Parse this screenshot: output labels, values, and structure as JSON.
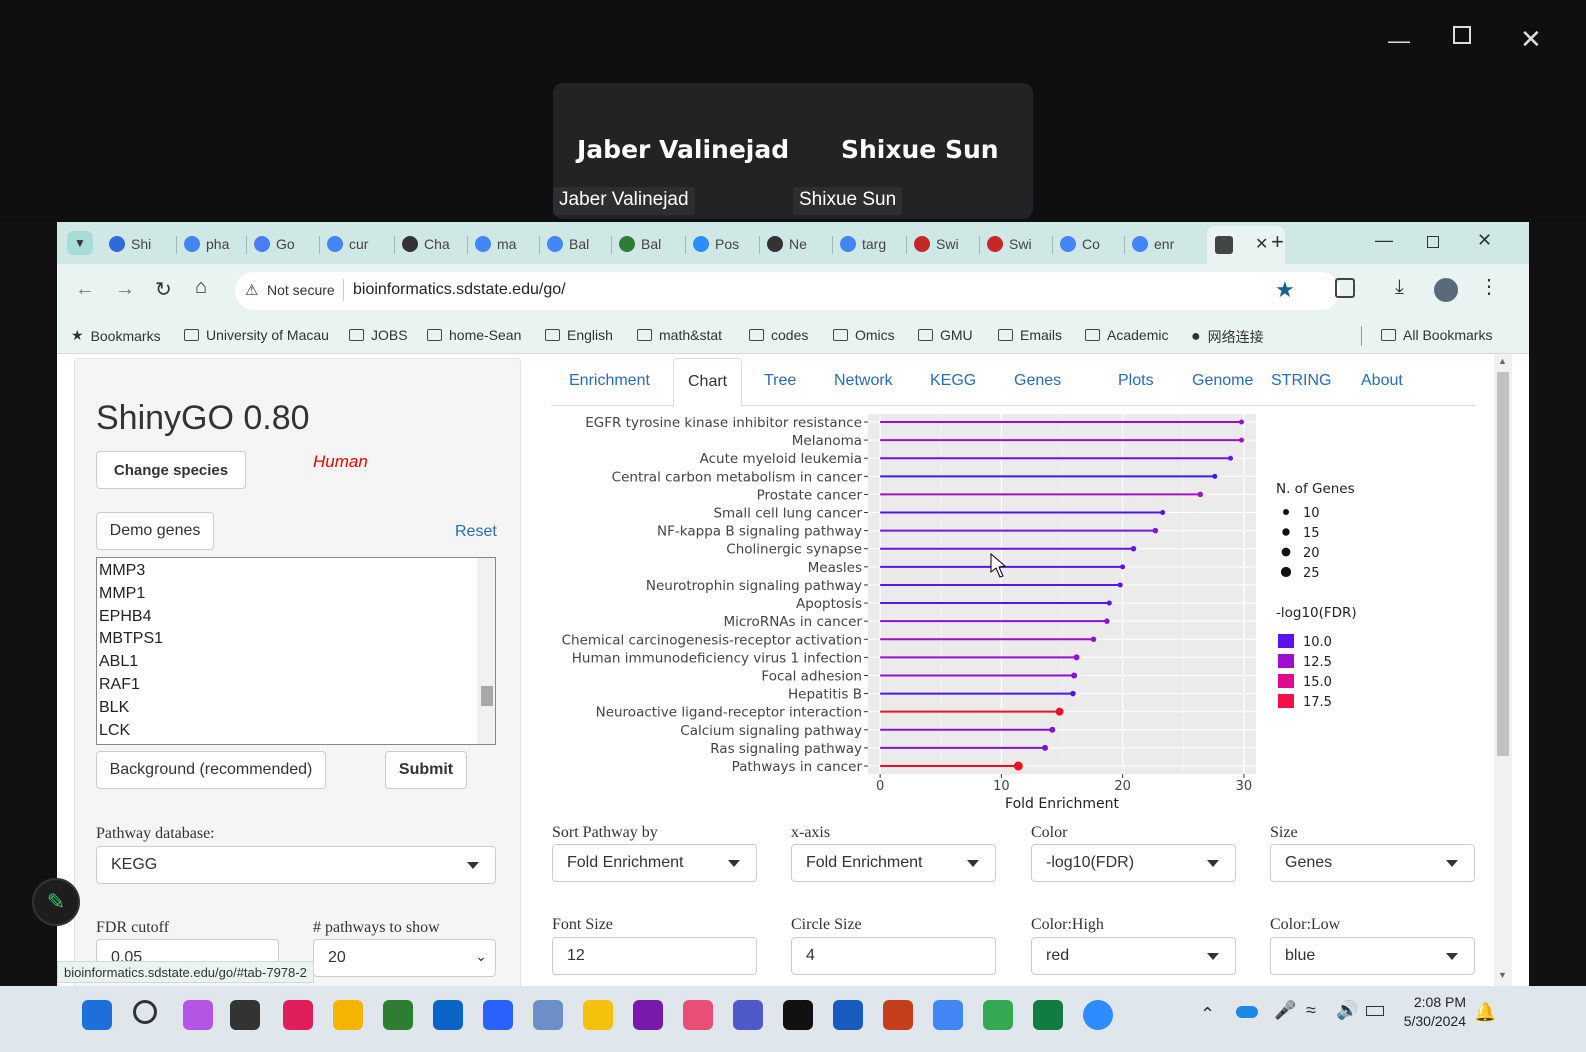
{
  "zoom": {
    "participants": [
      {
        "display_name": "Jaber Valinejad",
        "tag": "Jaber Valinejad"
      },
      {
        "display_name": "Shixue Sun",
        "tag": "Shixue Sun"
      }
    ]
  },
  "browser": {
    "tabs": [
      "Shi",
      "pha",
      "Go",
      "cur",
      "Cha",
      "ma",
      "Bal",
      "Bal",
      "Pos",
      "Ne",
      "targ",
      "Swi",
      "Swi",
      "Co",
      "enr"
    ],
    "security_label": "Not secure",
    "url": "bioinformatics.sdstate.edu/go/",
    "bookmarks": [
      "Bookmarks",
      "University of Macau",
      "JOBS",
      "home-Sean",
      "English",
      "math&stat",
      "codes",
      "Omics",
      "GMU",
      "Emails",
      "Academic",
      "网络连接"
    ],
    "all_bookmarks": "All Bookmarks",
    "status_url": "bioinformatics.sdstate.edu/go/#tab-7978-2"
  },
  "app": {
    "title": "ShinyGO 0.80",
    "change_species": "Change species",
    "species": "Human",
    "demo_genes": "Demo genes",
    "reset": "Reset",
    "genes": [
      "MMP3",
      "MMP1",
      "EPHB4",
      "MBTPS1",
      "ABL1",
      "RAF1",
      "BLK",
      "LCK"
    ],
    "background_button": "Background (recommended)",
    "submit": "Submit",
    "pathway_db_label": "Pathway database:",
    "pathway_db_value": "KEGG",
    "fdr_label": "FDR cutoff",
    "fdr_value": "0.05",
    "pathways_label": "# pathways to show",
    "pathways_value": "20",
    "tabs": [
      "Enrichment",
      "Chart",
      "Tree",
      "Network",
      "KEGG",
      "Genes",
      "Plots",
      "Genome",
      "STRING",
      "About"
    ],
    "active_tab": "Chart",
    "controls": {
      "sort_label": "Sort Pathway by",
      "sort_value": "Fold Enrichment",
      "xaxis_label": "x-axis",
      "xaxis_value": "Fold Enrichment",
      "color_label": "Color",
      "color_value": "-log10(FDR)",
      "size_label": "Size",
      "size_value": "Genes",
      "font_label": "Font Size",
      "font_value": "12",
      "circle_label": "Circle Size",
      "circle_value": "4",
      "high_label": "Color:High",
      "high_value": "red",
      "low_label": "Color:Low",
      "low_value": "blue"
    }
  },
  "chart_data": {
    "type": "scatter",
    "subtype": "lollipop",
    "xlabel": "Fold Enrichment",
    "xlim": [
      -1,
      31
    ],
    "xticks": [
      0,
      10,
      20,
      30
    ],
    "categories": [
      "EGFR tyrosine kinase inhibitor resistance",
      "Melanoma",
      "Acute myeloid leukemia",
      "Central carbon metabolism in cancer",
      "Prostate cancer",
      "Small cell lung cancer",
      "NF-kappa B signaling pathway",
      "Cholinergic synapse",
      "Measles",
      "Neurotrophin signaling pathway",
      "Apoptosis",
      "MicroRNAs in cancer",
      "Chemical carcinogenesis-receptor activation",
      "Human immunodeficiency virus 1 infection",
      "Focal adhesion",
      "Hepatitis B",
      "Neuroactive ligand-receptor interaction",
      "Calcium signaling pathway",
      "Ras signaling pathway",
      "Pathways in cancer"
    ],
    "values": [
      29.8,
      29.8,
      28.9,
      27.6,
      26.4,
      23.3,
      22.7,
      20.9,
      20.0,
      19.8,
      18.9,
      18.7,
      17.6,
      16.2,
      16.0,
      15.9,
      14.8,
      14.2,
      13.6,
      11.4
    ],
    "colors": [
      "#9b0fd0",
      "#9b0fd0",
      "#6a12e8",
      "#3a1aee",
      "#a80fc8",
      "#4a18ec",
      "#7a14de",
      "#6514e4",
      "#5a16e6",
      "#5a16e6",
      "#5a16e6",
      "#8a12d2",
      "#a00ec8",
      "#9a10cc",
      "#8a12d2",
      "#4a18ec",
      "#f01020",
      "#8a12d2",
      "#7e14d6",
      "#ee1020"
    ],
    "sizes": [
      10,
      10,
      10,
      10,
      11,
      10,
      11,
      11,
      10,
      10,
      10,
      11,
      11,
      12,
      12,
      11,
      16,
      12,
      12,
      18
    ],
    "legend_size": {
      "title": "N. of Genes",
      "values": [
        10,
        15,
        20,
        25
      ]
    },
    "legend_color": {
      "title": "-log10(FDR)",
      "values": [
        10.0,
        12.5,
        15.0,
        17.5
      ],
      "colors": [
        "#5a13ef",
        "#a00fd0",
        "#e00a90",
        "#f5104a"
      ]
    }
  },
  "taskbar": {
    "time": "2:08 PM",
    "date": "5/30/2024"
  }
}
